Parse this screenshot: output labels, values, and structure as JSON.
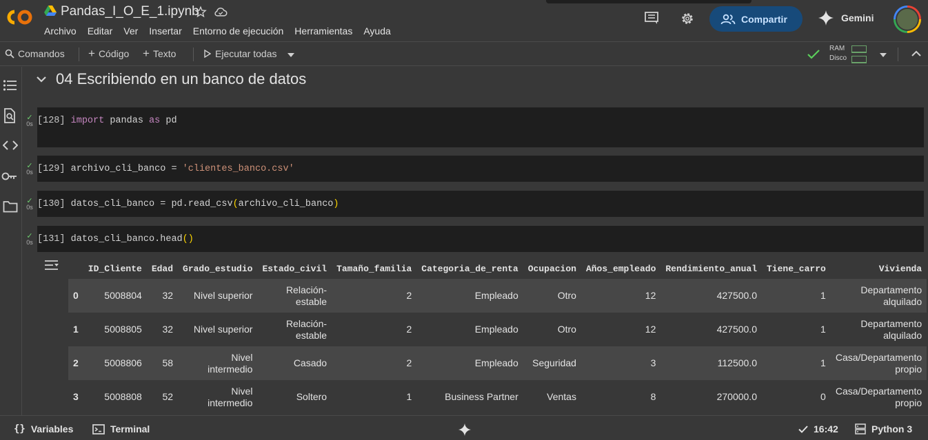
{
  "header": {
    "logo_text": "CO",
    "title": "Pandas_I_O_E_1.ipynb",
    "menu": [
      "Archivo",
      "Editar",
      "Ver",
      "Insertar",
      "Entorno de ejecución",
      "Herramientas",
      "Ayuda"
    ],
    "share_label": "Compartir",
    "gemini_label": "Gemini",
    "accent": "#174a7a"
  },
  "toolbar": {
    "commands": "Comandos",
    "code": "Código",
    "text": "Texto",
    "run_all": "Ejecutar todas",
    "ram": "RAM",
    "disk": "Disco"
  },
  "section": {
    "title": "04 Escribiendo en un banco de datos"
  },
  "cells": [
    {
      "exec": "[128]",
      "time": "0s",
      "code": "import pandas as pd"
    },
    {
      "exec": "[129]",
      "time": "0s",
      "code": "archivo_cli_banco = 'clientes_banco.csv'"
    },
    {
      "exec": "[130]",
      "time": "0s",
      "code": "datos_cli_banco = pd.read_csv(archivo_cli_banco)"
    },
    {
      "exec": "[131]",
      "time": "0s",
      "code": "datos_cli_banco.head()"
    }
  ],
  "dataframe": {
    "columns": [
      "",
      "ID_Cliente",
      "Edad",
      "Grado_estudio",
      "Estado_civil",
      "Tamaño_familia",
      "Categoria_de_renta",
      "Ocupacion",
      "Años_empleado",
      "Rendimiento_anual",
      "Tiene_carro",
      "Vivienda"
    ],
    "rows": [
      [
        "0",
        "5008804",
        "32",
        "Nivel superior",
        "Relación-\nestable",
        "2",
        "Empleado",
        "Otro",
        "12",
        "427500.0",
        "1",
        "Departamento\nalquilado"
      ],
      [
        "1",
        "5008805",
        "32",
        "Nivel superior",
        "Relación-\nestable",
        "2",
        "Empleado",
        "Otro",
        "12",
        "427500.0",
        "1",
        "Departamento\nalquilado"
      ],
      [
        "2",
        "5008806",
        "58",
        "Nivel\nintermedio",
        "Casado",
        "2",
        "Empleado",
        "Seguridad",
        "3",
        "112500.0",
        "1",
        "Casa/Departamento\npropio"
      ],
      [
        "3",
        "5008808",
        "52",
        "Nivel\nintermedio",
        "Soltero",
        "1",
        "Business Partner",
        "Ventas",
        "8",
        "270000.0",
        "0",
        "Casa/Departamento\npropio"
      ]
    ]
  },
  "bottom": {
    "variables": "Variables",
    "terminal": "Terminal",
    "time": "16:42",
    "runtime": "Python 3"
  }
}
